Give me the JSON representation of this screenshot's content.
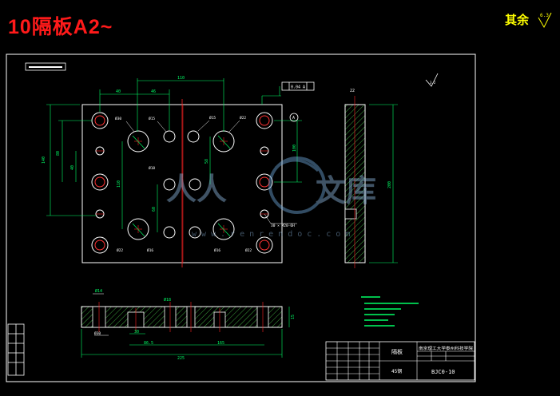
{
  "header": {
    "title": "10隔板A2~",
    "remaining_label": "其余",
    "roughness_symbol": "6.3"
  },
  "drawing": {
    "tolerance_frame": "0.04 A",
    "datum_label": "A",
    "hole_labels": {
      "counterbore": "Ø30",
      "hole_22": "Ø22",
      "hole_15": "Ø15",
      "hole_18": "Ø18",
      "hole_16": "Ø16"
    },
    "thread_note": "30 × M20-6H"
  },
  "watermark": {
    "text": "www.renrendoc.com"
  },
  "title_block": {
    "part_name": "隔板",
    "school": "南京理工大学泰州科技学院",
    "drawing_number": "BJC0-10",
    "material": "45钢"
  }
}
